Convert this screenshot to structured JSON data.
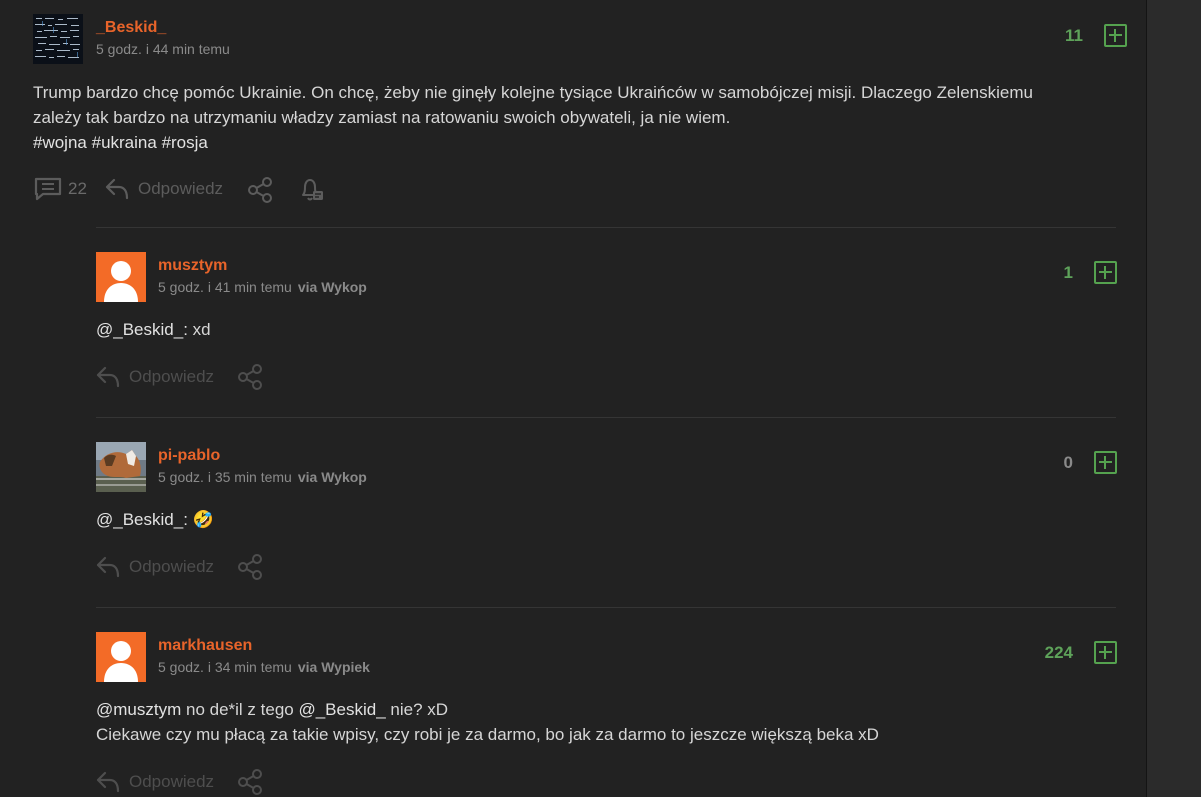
{
  "post": {
    "author": "_Beskid_",
    "time": "5 godz. i 44 min temu",
    "votes": "11",
    "body_line1": "Trump bardzo chcę pomóc Ukrainie. On chcę, żeby nie ginęły kolejne tysiące Ukraińców w samobójczej misji. Dlaczego Zelenskiemu",
    "body_line2": "zależy tak bardzo na utrzymaniu władzy zamiast na ratowaniu swoich obywateli, ja nie wiem.",
    "tags": [
      "#wojna",
      "#ukraina",
      "#rosja"
    ],
    "comment_count": "22",
    "reply_label": "Odpowiedz"
  },
  "comments": [
    {
      "author": "musztym",
      "time": "5 godz. i 41 min temu",
      "via": "via Wykop",
      "votes": "1",
      "mention": "@_Beskid_:",
      "text": " xd",
      "reply_label": "Odpowiedz"
    },
    {
      "author": "pi-pablo",
      "time": "5 godz. i 35 min temu",
      "via": "via Wykop",
      "votes": "0",
      "mention": "@_Beskid_:",
      "text": " 🤣",
      "reply_label": "Odpowiedz"
    },
    {
      "author": "markhausen",
      "time": "5 godz. i 34 min temu",
      "via": "via Wypiek",
      "votes": "224",
      "mention1": "@musztym",
      "text1": " no de*il z tego ",
      "mention2": "@_Beskid_",
      "text2": " nie? xD",
      "line2": "Ciekawe czy mu płacą za takie wpisy, czy robi je za darmo, bo jak za darmo to jeszcze większą beka xD",
      "reply_label": "Odpowiedz"
    }
  ],
  "colors": {
    "username": "#e8642a",
    "vote_positive": "#5ea25a",
    "plus": "#55a24f",
    "avatar_default": "#f36b27"
  }
}
